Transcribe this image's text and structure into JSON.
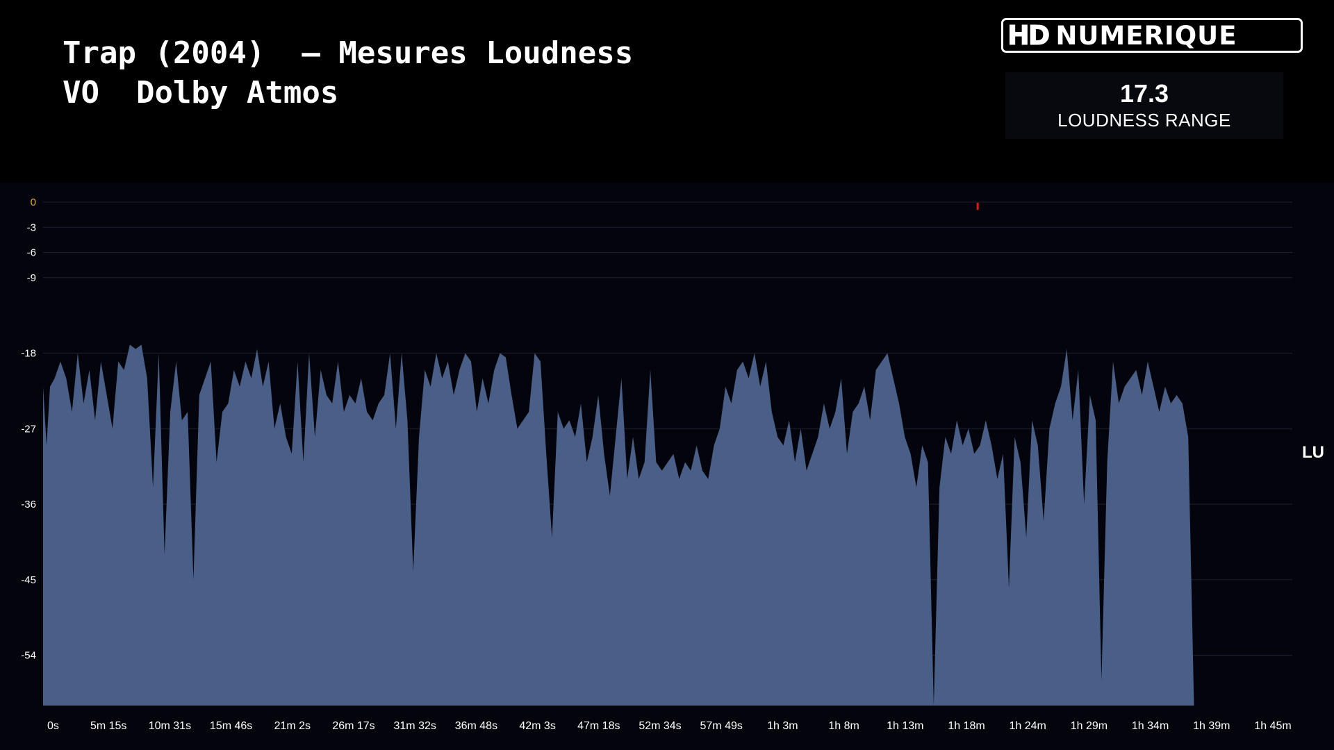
{
  "header": {
    "title_line1": "Trap (2004)  – Mesures Loudness",
    "title_line2": "VO  Dolby Atmos"
  },
  "logo": {
    "hd": "HD",
    "name": "NUMERIQUE"
  },
  "loudness_range": {
    "value": "17.3",
    "label": "LOUDNESS RANGE"
  },
  "unit": "LU",
  "colors": {
    "background": "#000000",
    "plot_background": "#04050c",
    "area_fill": "#4a5f87",
    "grid": "#1d2130",
    "tick_text": "#ffffff",
    "zero_tick": "#f0b030",
    "peak_marker": "#e01818"
  },
  "chart_data": {
    "type": "area",
    "title": "",
    "xlabel": "",
    "ylabel": "LU",
    "ylim": [
      -60,
      0
    ],
    "xlim_minutes": [
      0,
      108
    ],
    "y_ticks": [
      0,
      -3,
      -6,
      -9,
      -18,
      -27,
      -36,
      -45,
      -54
    ],
    "x_ticks": [
      "0s",
      "5m 15s",
      "10m 31s",
      "15m 46s",
      "21m 2s",
      "26m 17s",
      "31m 32s",
      "36m 48s",
      "42m 3s",
      "47m 18s",
      "52m 34s",
      "57m 49s",
      "1h 3m",
      "1h 8m",
      "1h 13m",
      "1h 18m",
      "1h 24m",
      "1h 29m",
      "1h 34m",
      "1h 39m",
      "1h 45m"
    ],
    "peak_marker": {
      "x_minutes": 80.8,
      "y": -0.5
    },
    "series": [
      {
        "x_minutes": [
          0,
          0.3,
          0.6,
          1,
          1.5,
          2,
          2.5,
          3,
          3.5,
          4,
          4.5,
          5,
          5.5,
          6,
          6.5,
          7,
          7.5,
          8,
          8.5,
          9,
          9.5,
          10,
          10.5,
          11,
          11.5,
          12,
          12.5,
          13,
          13.5,
          14,
          14.5,
          15,
          15.5,
          16,
          16.5,
          17,
          17.5,
          18,
          18.5,
          19,
          19.5,
          20,
          20.5,
          21,
          21.5,
          22,
          22.5,
          23,
          23.5,
          24,
          24.5,
          25,
          25.5,
          26,
          26.5,
          27,
          27.5,
          28,
          28.5,
          29,
          29.5,
          30,
          30.5,
          31,
          31.5,
          32,
          32.5,
          33,
          33.5,
          34,
          34.5,
          35,
          35.5,
          36,
          36.5,
          37,
          37.5,
          38,
          38.5,
          39,
          39.5,
          40,
          40.5,
          41,
          41.5,
          42,
          42.5,
          43,
          43.5,
          44,
          44.5,
          45,
          45.5,
          46,
          46.5,
          47,
          47.5,
          48,
          48.5,
          49,
          49.5,
          50,
          50.5,
          51,
          51.5,
          52,
          52.5,
          53,
          53.5,
          54,
          54.5,
          55,
          55.5,
          56,
          56.5,
          57,
          57.5,
          58,
          58.5,
          59,
          59.5,
          60,
          60.5,
          61,
          61.5,
          62,
          62.5,
          63,
          63.5,
          64,
          64.5,
          65,
          65.5,
          66,
          66.5,
          67,
          67.5,
          68,
          68.5,
          69,
          69.5,
          70,
          70.5,
          71,
          71.5,
          72,
          72.5,
          73,
          73.5,
          74,
          74.5,
          75,
          75.5,
          76,
          76.5,
          77,
          77.5,
          78,
          78.5,
          79,
          79.5,
          80,
          80.5,
          81,
          81.5,
          82,
          82.5,
          83,
          83.5,
          84,
          84.5,
          85,
          85.5,
          86,
          86.5,
          87,
          87.5,
          88,
          88.5,
          89,
          89.5,
          90,
          90.5,
          91,
          91.5,
          92,
          92.5,
          93,
          93.5,
          94,
          94.5,
          95,
          95.5,
          96,
          96.5,
          97,
          97.5,
          98,
          98.5,
          99,
          99.5,
          100,
          100.5,
          101,
          101.5,
          102,
          102.5,
          103,
          103.5,
          104,
          104.5,
          105,
          105.5,
          106,
          106.5,
          107,
          107.5,
          108
        ],
        "values": [
          -22,
          -29,
          -22,
          -21,
          -19,
          -21,
          -25,
          -18,
          -24,
          -20,
          -26,
          -19,
          -23,
          -27,
          -19,
          -20,
          -17,
          -17.5,
          -17,
          -21,
          -34,
          -18,
          -42,
          -25,
          -19,
          -26,
          -25,
          -45,
          -23,
          -21,
          -19,
          -31,
          -25,
          -24,
          -20,
          -22,
          -19,
          -21,
          -17.5,
          -22,
          -19,
          -27,
          -24,
          -28,
          -30,
          -19,
          -31,
          -18,
          -28,
          -20,
          -23,
          -24,
          -19,
          -25,
          -23,
          -24,
          -21,
          -25,
          -26,
          -24,
          -23,
          -18,
          -27,
          -18,
          -26,
          -44,
          -28,
          -20,
          -22,
          -18,
          -21,
          -19,
          -23,
          -20,
          -18,
          -19,
          -25,
          -21,
          -24,
          -20,
          -18,
          -18.5,
          -23,
          -27,
          -26,
          -25,
          -18,
          -19,
          -30,
          -40,
          -25,
          -27,
          -26,
          -28,
          -24,
          -31,
          -28,
          -23,
          -30,
          -35,
          -28,
          -21,
          -33,
          -28,
          -33,
          -31,
          -20,
          -31,
          -32,
          -31,
          -30,
          -33,
          -31,
          -32,
          -29,
          -32,
          -33,
          -29,
          -27,
          -22,
          -24,
          -20,
          -19,
          -21,
          -18,
          -22,
          -19,
          -25,
          -28,
          -29,
          -26,
          -31,
          -27,
          -32,
          -30,
          -28,
          -24,
          -27,
          -25,
          -21,
          -30,
          -25,
          -24,
          -22,
          -26,
          -20,
          -19,
          -18,
          -21,
          -24,
          -28,
          -30,
          -34,
          -29,
          -31,
          -60,
          -34,
          -28,
          -30,
          -26,
          -29,
          -27,
          -30,
          -29,
          -26,
          -29,
          -33,
          -30,
          -46,
          -28,
          -31,
          -40,
          -26,
          -29,
          -38,
          -27,
          -24,
          -22,
          -17.5,
          -26,
          -20,
          -36,
          -23,
          -26,
          -57,
          -31,
          -19,
          -24,
          -22,
          -21,
          -20,
          -23,
          -19,
          -22,
          -25,
          -22,
          -24,
          -23,
          -24,
          -28,
          -60
        ]
      }
    ]
  }
}
